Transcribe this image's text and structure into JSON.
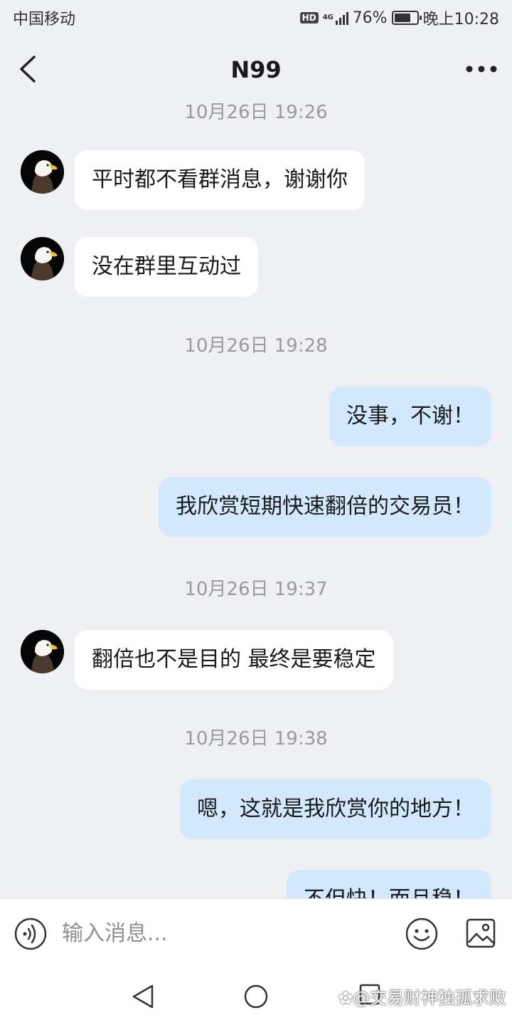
{
  "status_bar": {
    "carrier": "中国移动",
    "hd": "HD",
    "network": "4G",
    "battery": "76%",
    "battery_level": 0.76,
    "time": "晚上10:28"
  },
  "header": {
    "title": "N99",
    "back_icon": "chevron-left-icon",
    "more_icon": "more-horizontal-icon"
  },
  "messages": {
    "ts_top": "10月26日 19:26",
    "m1": "平时都不看群消息，谢谢你",
    "m2": "没在群里互动过",
    "ts_2": "10月26日 19:28",
    "m3": "没事，不谢！",
    "m4": "我欣赏短期快速翻倍的交易员！",
    "ts_3": "10月26日 19:37",
    "m5": "翻倍也不是目的 最终是要稳定",
    "ts_4": "10月26日 19:38",
    "m6": "嗯，这就是我欣赏你的地方！",
    "m7": "不但快！而且稳！"
  },
  "input": {
    "placeholder": "输入消息..."
  },
  "watermark": "交易财神独孤求败",
  "colors": {
    "background": "#eef0f3",
    "incoming_bubble": "#ffffff",
    "outgoing_bubble": "#d2e8fd"
  }
}
